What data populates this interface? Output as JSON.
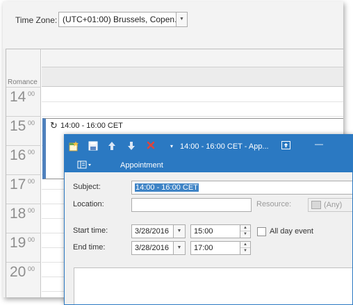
{
  "toolbar": {
    "timezone_label": "Time Zone:",
    "timezone_value": "(UTC+01:00) Brussels, Copen..."
  },
  "scheduler": {
    "timezone_caption": "Romance",
    "hours": [
      {
        "hour": "14",
        "min": "00"
      },
      {
        "hour": "15",
        "min": "00"
      },
      {
        "hour": "16",
        "min": "00"
      },
      {
        "hour": "17",
        "min": "00"
      },
      {
        "hour": "18",
        "min": "00"
      },
      {
        "hour": "19",
        "min": "00"
      },
      {
        "hour": "20",
        "min": "00"
      }
    ],
    "appointment": {
      "text": "14:00 - 16:00 CET",
      "recurring_icon": "↻"
    }
  },
  "dialog": {
    "title": "14:00 - 16:00 CET - App...",
    "ribbon_tab": "Appointment",
    "subject_label": "Subject:",
    "subject_value": "14:00 - 16:00 CET",
    "location_label": "Location:",
    "location_value": "",
    "resource_label": "Resource:",
    "resource_value": "(Any)",
    "start_label": "Start time:",
    "start_date": "3/28/2016",
    "start_time": "15:00",
    "all_day_label": "All day event",
    "all_day_checked": false,
    "end_label": "End time:",
    "end_date": "3/28/2016",
    "end_time": "17:00"
  },
  "colors": {
    "accent": "#2b79c2",
    "appointment_status": "#4f81bd",
    "selection": "#3f84c6"
  }
}
